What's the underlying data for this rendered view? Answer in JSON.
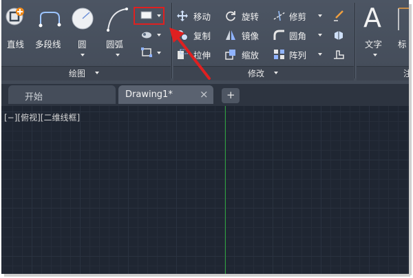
{
  "ribbon": {
    "draw_group": {
      "title": "绘图",
      "tools": {
        "line": "直线",
        "polyline": "多段线",
        "circle": "圆",
        "arc": "圆弧"
      }
    },
    "modify_group": {
      "title": "修改",
      "tools": {
        "move": "移动",
        "rotate": "旋转",
        "trim": "修剪",
        "copy": "复制",
        "mirror": "镜像",
        "fillet": "圆角",
        "stretch": "拉伸",
        "scale": "缩放",
        "array": "阵列"
      }
    },
    "annotation_group": {
      "tools": {
        "text": "文字",
        "cut_label": "标"
      },
      "text_glyph": "A",
      "cut_title": "注"
    }
  },
  "file_tabs": [
    {
      "label": "开始",
      "active": false
    },
    {
      "label": "Drawing1*",
      "active": true,
      "close": "×"
    }
  ],
  "new_tab": "+",
  "viewport": {
    "label": "[−][俯视][二维线框]"
  },
  "colors": {
    "highlight": "#e02020",
    "y_axis": "#2fa33c",
    "canvas": "#1f2632"
  }
}
